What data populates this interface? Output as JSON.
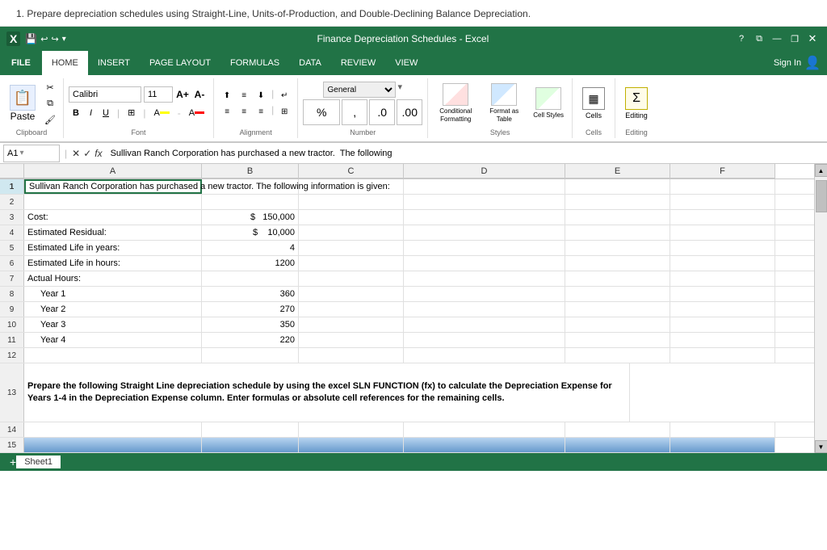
{
  "instruction": "1. Prepare depreciation schedules using Straight-Line, Units-of-Production, and Double-Declining Balance Depreciation.",
  "titleBar": {
    "logo": "X",
    "title": "Finance Depreciation Schedules - Excel",
    "help": "?",
    "restore": "⧉",
    "minimize": "—",
    "maximize": "❐",
    "close": "✕"
  },
  "ribbon": {
    "tabs": [
      "FILE",
      "HOME",
      "INSERT",
      "PAGE LAYOUT",
      "FORMULAS",
      "DATA",
      "REVIEW",
      "VIEW"
    ],
    "activeTab": "HOME",
    "signIn": "Sign In",
    "groups": {
      "clipboard": "Clipboard",
      "font": "Font",
      "alignment": "Alignment",
      "number": "Number",
      "styles": "Styles",
      "cells": "Cells",
      "editing": "Editing"
    },
    "buttons": {
      "paste": "Paste",
      "bold": "B",
      "italic": "I",
      "underline": "U",
      "percent": "%",
      "conditionalFormatting": "Conditional Formatting",
      "formatAsTable": "Format as Table",
      "cellStyles": "Cell Styles",
      "cells": "Cells",
      "editing": "Editing"
    },
    "font": {
      "name": "Calibri",
      "size": "11"
    }
  },
  "formulaBar": {
    "cellRef": "A1",
    "fx": "fx",
    "content": "Sullivan Ranch Corporation has purchased a new tractor.  The following"
  },
  "grid": {
    "columns": [
      "A",
      "B",
      "C",
      "D",
      "E",
      "F"
    ],
    "rows": [
      {
        "num": "1",
        "cells": [
          "Sullivan Ranch Corporation has purchased a new tractor.  The following information is given:",
          "",
          "",
          "",
          "",
          ""
        ],
        "selected": true
      },
      {
        "num": "2",
        "cells": [
          "",
          "",
          "",
          "",
          "",
          ""
        ]
      },
      {
        "num": "3",
        "cells": [
          "Cost:",
          "$ 150,000",
          "",
          "",
          "",
          ""
        ]
      },
      {
        "num": "4",
        "cells": [
          "Estimated Residual:",
          "$ 10,000",
          "",
          "",
          "",
          ""
        ]
      },
      {
        "num": "5",
        "cells": [
          "Estimated Life in years:",
          "4",
          "",
          "",
          "",
          ""
        ]
      },
      {
        "num": "6",
        "cells": [
          "Estimated Life in hours:",
          "1200",
          "",
          "",
          "",
          ""
        ]
      },
      {
        "num": "7",
        "cells": [
          "Actual Hours:",
          "",
          "",
          "",
          "",
          ""
        ]
      },
      {
        "num": "8",
        "cells": [
          "  Year 1",
          "360",
          "",
          "",
          "",
          ""
        ]
      },
      {
        "num": "9",
        "cells": [
          "  Year 2",
          "270",
          "",
          "",
          "",
          ""
        ]
      },
      {
        "num": "10",
        "cells": [
          "  Year 3",
          "350",
          "",
          "",
          "",
          ""
        ]
      },
      {
        "num": "11",
        "cells": [
          "  Year 4",
          "220",
          "",
          "",
          "",
          ""
        ]
      },
      {
        "num": "12",
        "cells": [
          "",
          "",
          "",
          "",
          "",
          ""
        ]
      },
      {
        "num": "13",
        "cells": [
          "Prepare the following Straight Line depreciation schedule by using the excel SLN FUNCTION (fx) to calculate the Depreciation Expense for Years 1-4 in the Depreciation Expense column. Enter formulas or absolute cell references for the remaining cells.",
          "",
          "",
          "",
          "",
          ""
        ],
        "tall": true,
        "bold": true
      },
      {
        "num": "14",
        "cells": [
          "",
          "",
          "",
          "",
          "",
          ""
        ]
      },
      {
        "num": "15",
        "cells": [
          "",
          "",
          "",
          "",
          "",
          ""
        ],
        "highlight": true
      }
    ]
  },
  "statusBar": {
    "sheetName": "Sheet1"
  }
}
